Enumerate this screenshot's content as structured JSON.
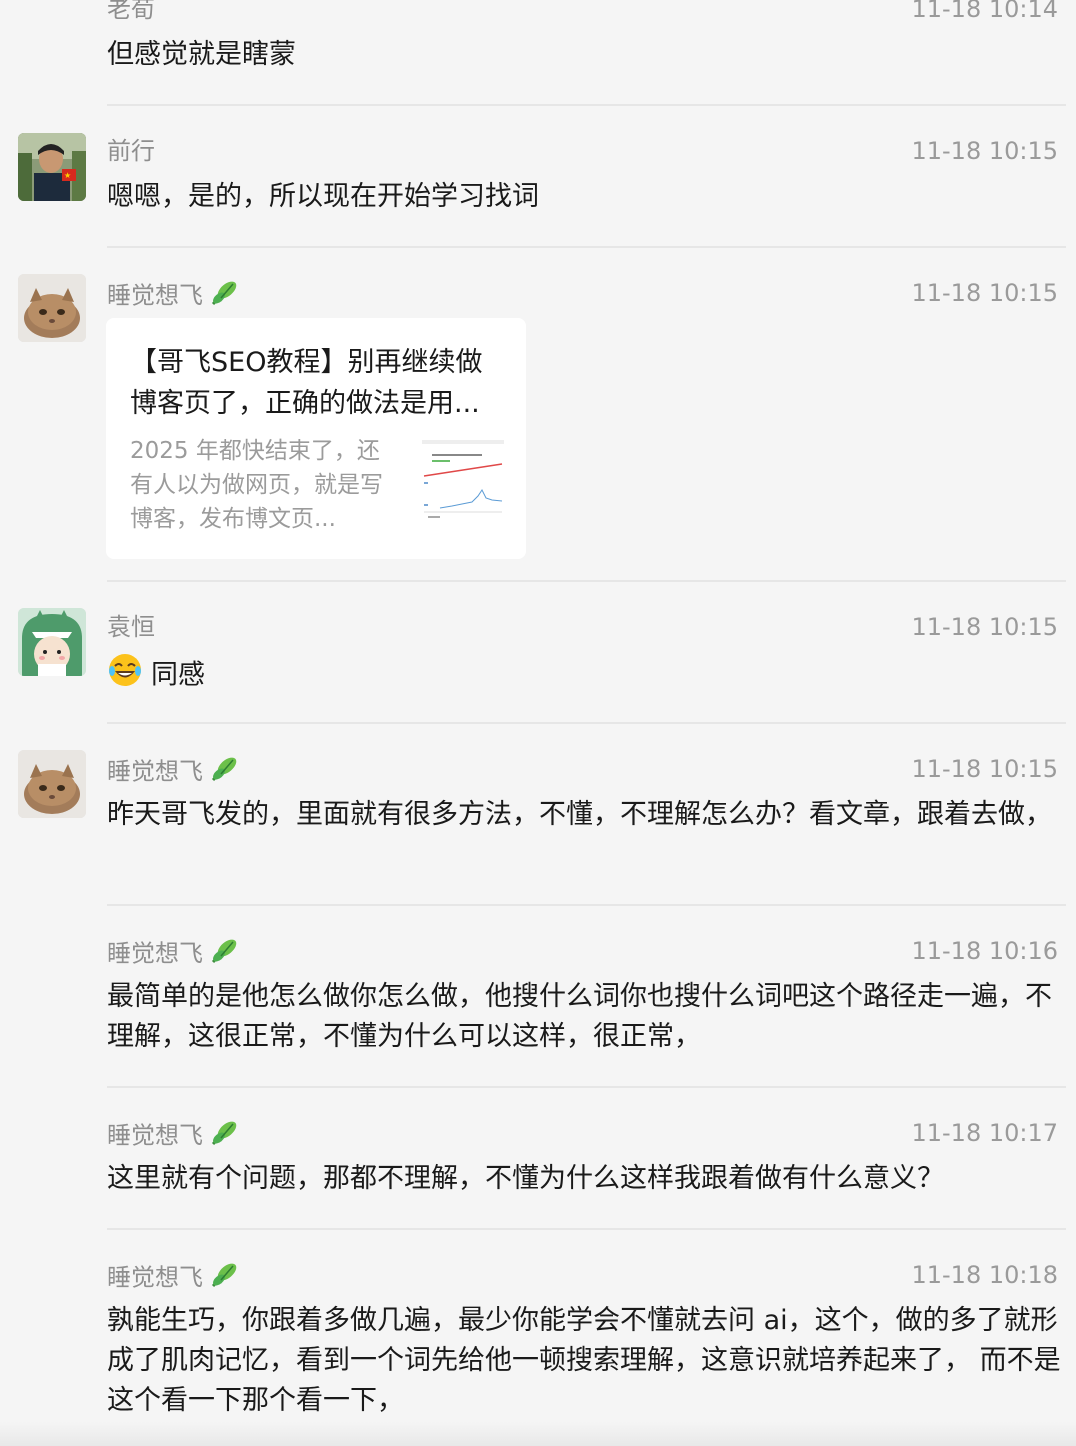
{
  "messages": [
    {
      "sender": "老荀",
      "time": "11-18 10:14",
      "text": "但感觉就是瞎蒙"
    },
    {
      "sender": "前行",
      "time": "11-18 10:15",
      "text": "嗯嗯，是的，所以现在开始学习找词"
    },
    {
      "sender": "睡觉想飞",
      "time": "11-18 10:15",
      "card": {
        "title": "【哥飞SEO教程】别再继续做博客页了，正确的做法是用...",
        "description": "2025 年都快结束了，还有人以为做网页，就是写博客，发布博文页..."
      }
    },
    {
      "sender": "袁恒",
      "time": "11-18 10:15",
      "text": "同感",
      "emoji": "laughing-tears-emoji"
    },
    {
      "sender": "睡觉想飞",
      "time": "11-18 10:15",
      "text": "昨天哥飞发的，里面就有很多方法，不懂，不理解怎么办？看文章，跟着去做，"
    },
    {
      "sender": "睡觉想飞",
      "time": "11-18 10:16",
      "text": "最简单的是他怎么做你怎么做，他搜什么词你也搜什么词吧这个路径走一遍，不理解，这很正常，不懂为什么可以这样，很正常，"
    },
    {
      "sender": "睡觉想飞",
      "time": "11-18 10:17",
      "text": "这里就有个问题，那都不理解，不懂为什么这样我跟着做有什么意义？"
    },
    {
      "sender": "睡觉想飞",
      "time": "11-18 10:18",
      "text": "孰能生巧，你跟着多做几遍，最少你能学会不懂就去问 ai，这个，做的多了就形成了肌肉记忆，看到一个词先给他一顿搜索理解，这意识就培养起来了， 而不是这个看一下那个看一下，"
    }
  ],
  "colors": {
    "background": "#f5f5f5",
    "name": "#8e8e8e",
    "time": "#9a9a9a",
    "card": "#ffffff",
    "leaf": "#5cb85c"
  }
}
